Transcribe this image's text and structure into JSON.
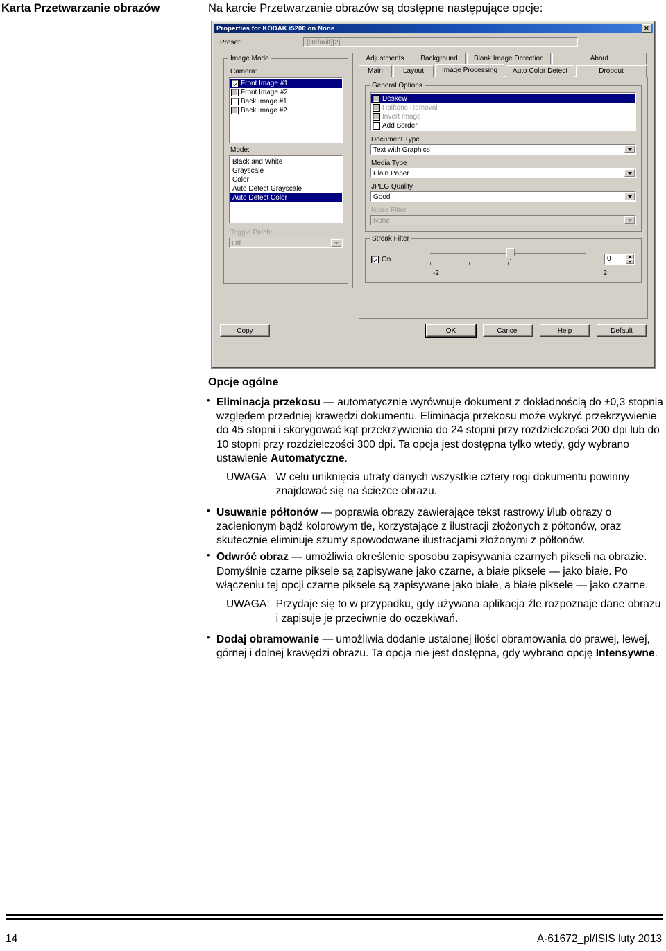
{
  "marginal_heading": "Karta Przetwarzanie obrazów",
  "intro": "Na karcie Przetwarzanie obrazów są dostępne następujące opcje:",
  "dialog": {
    "title": "Properties for KODAK i5200 on None",
    "close_label": "✕",
    "preset_label": "Preset:",
    "preset_value": "[Default][2]",
    "image_mode": {
      "legend": "Image Mode",
      "camera_label": "Camera:",
      "camera_items": [
        {
          "label": "Front Image #1",
          "state": "checked",
          "selected": true
        },
        {
          "label": "Front Image #2",
          "state": "gray",
          "selected": false
        },
        {
          "label": "Back Image #1",
          "state": "empty",
          "selected": false
        },
        {
          "label": "Back Image #2",
          "state": "gray",
          "selected": false
        }
      ],
      "mode_label": "Mode:",
      "mode_items": [
        {
          "label": "Black and White",
          "selected": false
        },
        {
          "label": "Grayscale",
          "selected": false
        },
        {
          "label": "Color",
          "selected": false
        },
        {
          "label": "Auto Detect Grayscale",
          "selected": false
        },
        {
          "label": "Auto Detect Color",
          "selected": true
        }
      ],
      "toggle_patch_label": "Toggle Patch:",
      "toggle_patch_value": "Off"
    },
    "tabs_row1": [
      {
        "label": "Adjustments",
        "active": false
      },
      {
        "label": "Background",
        "active": false
      },
      {
        "label": "Blank Image Detection",
        "active": false
      },
      {
        "label": "About",
        "active": false
      }
    ],
    "tabs_row2": [
      {
        "label": "Main",
        "active": false
      },
      {
        "label": "Layout",
        "active": false
      },
      {
        "label": "Image Processing",
        "active": true
      },
      {
        "label": "Auto Color Detect",
        "active": false
      },
      {
        "label": "Dropout",
        "active": false
      }
    ],
    "general_options": {
      "legend": "General Options",
      "items": [
        {
          "label": "Deskew",
          "state": "gray",
          "selected": true,
          "dim": true
        },
        {
          "label": "Halftone Removal",
          "state": "gray",
          "selected": false,
          "dim": true
        },
        {
          "label": "Invert Image",
          "state": "gray",
          "selected": false,
          "dim": true
        },
        {
          "label": "Add Border",
          "state": "empty",
          "selected": false,
          "dim": false
        }
      ],
      "document_type_label": "Document Type",
      "document_type_value": "Text with Graphics",
      "media_type_label": "Media Type",
      "media_type_value": "Plain Paper",
      "jpeg_quality_label": "JPEG Quality",
      "jpeg_quality_value": "Good",
      "noise_filter_label": "Noise Filter",
      "noise_filter_value": "None"
    },
    "streak_filter": {
      "legend": "Streak Filter",
      "on_label": "On",
      "on_checked": true,
      "value": "0",
      "scale_min": "-2",
      "scale_max": "2"
    },
    "buttons": [
      {
        "label": "Copy",
        "default": false
      },
      {
        "label": "OK",
        "default": true
      },
      {
        "label": "Cancel",
        "default": false
      },
      {
        "label": "Help",
        "default": false
      },
      {
        "label": "Default",
        "default": false
      }
    ]
  },
  "section": {
    "title": "Opcje ogólne",
    "bullet1": {
      "term": "Eliminacja przekosu",
      "text": " — automatycznie wyrównuje dokument z dokładnością do ±0,3 stopnia względem przedniej krawędzi dokumentu. Eliminacja przekosu może wykryć przekrzywienie do 45 stopni i skorygować kąt przekrzywienia do 24 stopni przy rozdzielczości 200 dpi lub do 10 stopni przy rozdzielczości 300 dpi. Ta opcja jest dostępna tylko wtedy, gdy wybrano ustawienie ",
      "term2": "Automatyczne",
      "tail": ".",
      "note_label": "UWAGA:",
      "note_text": "W celu uniknięcia utraty danych wszystkie cztery rogi dokumentu powinny znajdować się na ścieżce obrazu."
    },
    "bullet2": {
      "term": "Usuwanie półtonów",
      "text": " — poprawia obrazy zawierające tekst rastrowy i/lub obrazy o zacienionym bądź kolorowym tle, korzystające z ilustracji złożonych z półtonów, oraz skutecznie eliminuje szumy spowodowane ilustracjami złożonymi z półtonów."
    },
    "bullet3": {
      "term": "Odwróć obraz",
      "text": " — umożliwia określenie sposobu zapisywania czarnych pikseli na obrazie. Domyślnie czarne piksele są zapisywane jako czarne, a białe piksele — jako białe. Po włączeniu tej opcji czarne piksele są zapisywane jako białe, a białe piksele — jako czarne.",
      "note_label": "UWAGA:",
      "note_text": "Przydaje się to w przypadku, gdy używana aplikacja źle rozpoznaje dane obrazu i zapisuje je przeciwnie do oczekiwań."
    },
    "bullet4": {
      "term": "Dodaj obramowanie",
      "text": " — umożliwia dodanie ustalonej ilości obramowania do prawej, lewej, górnej i dolnej krawędzi obrazu. Ta opcja nie jest dostępna, gdy wybrano opcję ",
      "term2": "Intensywne",
      "tail": "."
    }
  },
  "footer": {
    "page_number": "14",
    "doc_code": "A-61672_pl/ISIS  luty 2013"
  }
}
